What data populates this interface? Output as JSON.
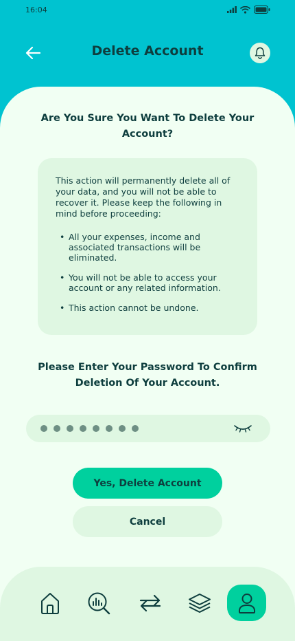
{
  "status_bar": {
    "time": "16:04"
  },
  "header": {
    "title": "Delete Account"
  },
  "question": "Are You Sure You Want To Delete Your Account?",
  "info": {
    "intro": "This action will permanently delete all of your data, and you will not be able to recover it. Please keep the following in mind before proceeding:",
    "items": [
      "All your expenses, income and associated transactions will be eliminated.",
      "You will not be able to access your account or any related information.",
      "This action cannot be undone."
    ]
  },
  "confirm_prompt": "Please Enter Your Password To Confirm Deletion Of Your Account.",
  "password": {
    "masked_length": 8
  },
  "buttons": {
    "delete": "Yes, Delete Account",
    "cancel": "Cancel"
  },
  "nav": {
    "items": [
      "home-icon",
      "analysis-icon",
      "transfer-icon",
      "layers-icon",
      "profile-icon"
    ],
    "active": "profile-icon"
  },
  "colors": {
    "header_bg": "#00C3D0",
    "sheet_bg": "#F1FFF3",
    "card_bg": "#DFF7E2",
    "accent": "#00D09E",
    "text": "#0E3E3E"
  }
}
